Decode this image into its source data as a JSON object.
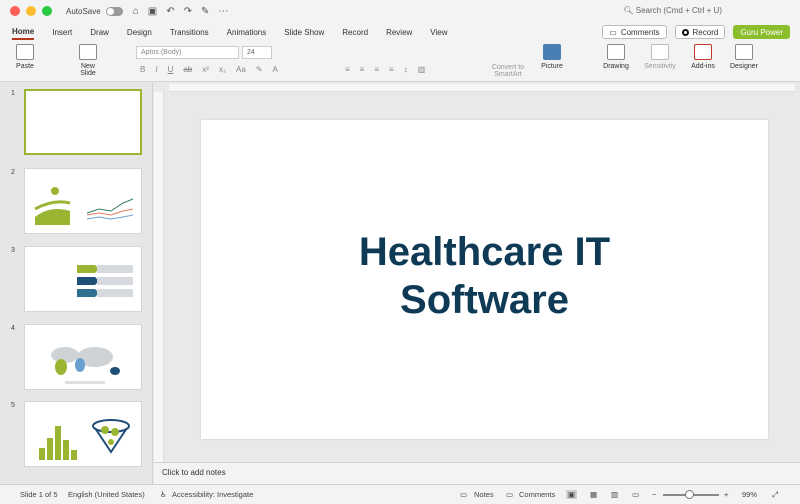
{
  "titlebar": {
    "autosave_label": "AutoSave",
    "search_placeholder": "Search (Cmd + Ctrl + U)"
  },
  "tabs": [
    "Home",
    "Insert",
    "Draw",
    "Design",
    "Transitions",
    "Animations",
    "Slide Show",
    "Record",
    "Review",
    "View"
  ],
  "tab_actions": {
    "comments": "Comments",
    "record": "Record",
    "guru": "Guru Power"
  },
  "ribbon": {
    "paste": "Paste",
    "new_slide_line1": "New",
    "new_slide_line2": "Slide",
    "font_name": "Aptos (Body)",
    "font_size": "24",
    "convert_line1": "Convert to",
    "convert_line2": "SmartArt",
    "picture": "Picture",
    "drawing": "Drawing",
    "sensitivity": "Sensitivity",
    "addins": "Add-ins",
    "designer": "Designer"
  },
  "slides": [
    {
      "number": "1"
    },
    {
      "number": "2"
    },
    {
      "number": "3"
    },
    {
      "number": "4"
    },
    {
      "number": "5"
    }
  ],
  "slide": {
    "title": "Healthcare IT\nSoftware"
  },
  "notes_placeholder": "Click to add notes",
  "status": {
    "slide_of": "Slide 1 of 5",
    "language": "English (United States)",
    "accessibility": "Accessibility: Investigate",
    "notes": "Notes",
    "comments": "Comments",
    "zoom": "99%"
  },
  "colors": {
    "accent_tab_underline": "#b5361c",
    "guru_button": "#8cbd2c",
    "slide_title": "#0e3a56",
    "thumb_selected_border": "#9ab532"
  }
}
